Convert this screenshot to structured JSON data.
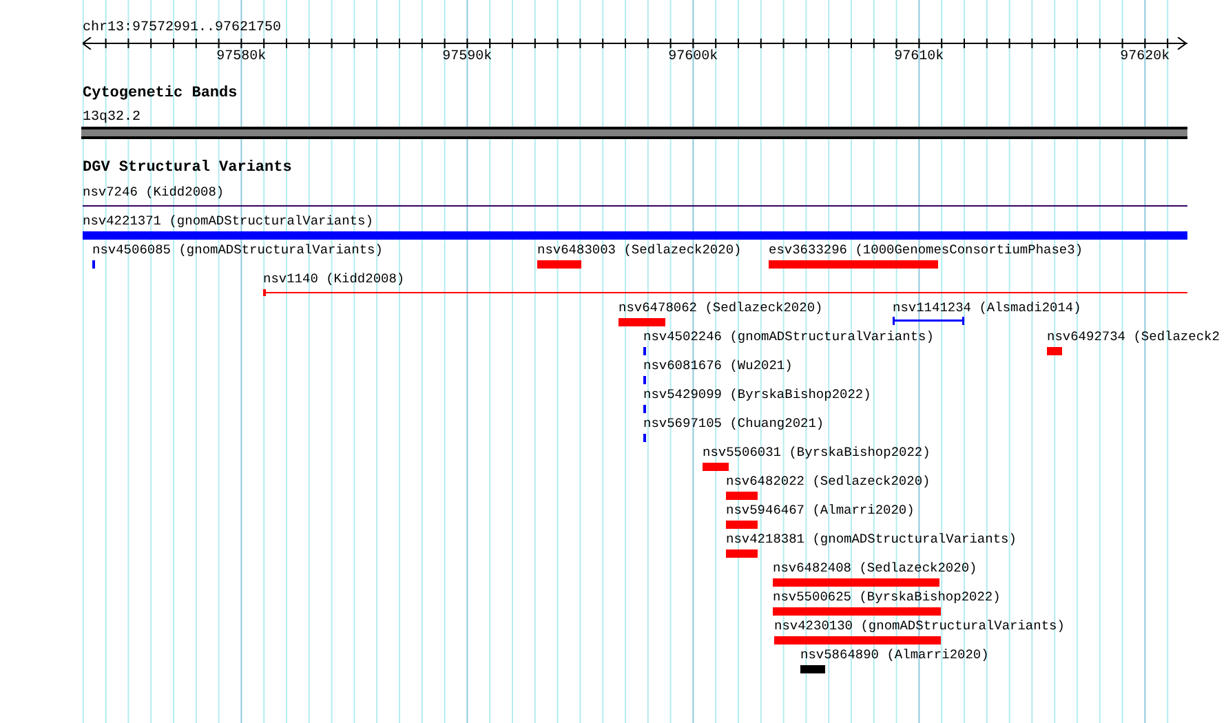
{
  "ruler": {
    "region": "chr13:97572991..97621750",
    "ticks": [
      "97580k",
      "97590k",
      "97600k",
      "97610k",
      "97620k"
    ]
  },
  "tracks": [
    {
      "title": "Cytogenetic Bands",
      "features": [
        {
          "label": "13q32.2",
          "kind": "band"
        }
      ]
    },
    {
      "title": "DGV Structural Variants",
      "features": [
        {
          "label": "nsv7246 (Kidd2008)",
          "kind": "line",
          "color": "#330066"
        },
        {
          "label": "nsv4221371 (gnomADStructuralVariants)",
          "kind": "bar",
          "color": "#0000ff"
        },
        {
          "label": "nsv4506085 (gnomADStructuralVariants)",
          "kind": "bar",
          "color": "#0000ff"
        },
        {
          "label": "nsv6483003 (Sedlazeck2020)",
          "kind": "bar",
          "color": "#ff0000"
        },
        {
          "label": "esv3633296 (1000GenomesConsortiumPhase3)",
          "kind": "bar",
          "color": "#ff0000"
        },
        {
          "label": "nsv1140 (Kidd2008)",
          "kind": "line",
          "color": "#ff0000"
        },
        {
          "label": "nsv6478062 (Sedlazeck2020)",
          "kind": "bar",
          "color": "#ff0000"
        },
        {
          "label": "nsv1141234 (Alsmadi2014)",
          "kind": "bracket",
          "color": "#0000ff"
        },
        {
          "label": "nsv4502246 (gnomADStructuralVariants)",
          "kind": "bar",
          "color": "#0000ff"
        },
        {
          "label": "nsv6492734 (Sedlazeck2",
          "kind": "bar",
          "color": "#ff0000"
        },
        {
          "label": "nsv6081676 (Wu2021)",
          "kind": "bar",
          "color": "#0000ff"
        },
        {
          "label": "nsv5429099 (ByrskaBishop2022)",
          "kind": "bar",
          "color": "#0000ff"
        },
        {
          "label": "nsv5697105 (Chuang2021)",
          "kind": "bar",
          "color": "#0000ff"
        },
        {
          "label": "nsv5506031 (ByrskaBishop2022)",
          "kind": "bar",
          "color": "#ff0000"
        },
        {
          "label": "nsv6482022 (Sedlazeck2020)",
          "kind": "bar",
          "color": "#ff0000"
        },
        {
          "label": "nsv5946467 (Almarri2020)",
          "kind": "bar",
          "color": "#ff0000"
        },
        {
          "label": "nsv4218381 (gnomADStructuralVariants)",
          "kind": "bar",
          "color": "#ff0000"
        },
        {
          "label": "nsv6482408 (Sedlazeck2020)",
          "kind": "bar",
          "color": "#ff0000"
        },
        {
          "label": "nsv5500625 (ByrskaBishop2022)",
          "kind": "bar",
          "color": "#ff0000"
        },
        {
          "label": "nsv4230130 (gnomADStructuralVariants)",
          "kind": "bar",
          "color": "#ff0000"
        },
        {
          "label": "nsv5864890 (Almarri2020)",
          "kind": "bar",
          "color": "#000000"
        }
      ]
    }
  ]
}
